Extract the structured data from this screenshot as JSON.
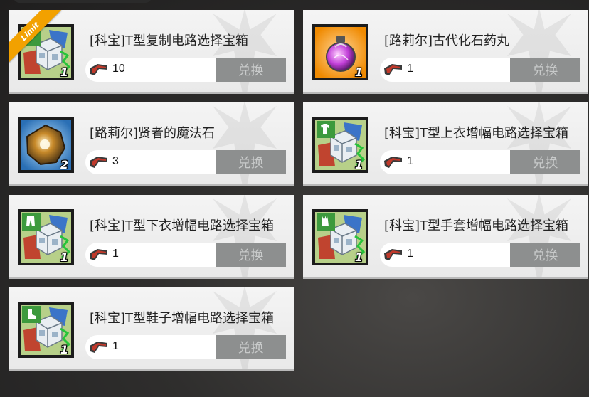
{
  "exchange_label": "兑换",
  "limit_label": "Limit",
  "items": [
    {
      "name": "[科宝]T型复制电路选择宝箱",
      "cost": "10",
      "qty": "1",
      "icon": "circuit-chip-gear-icon",
      "limit": true
    },
    {
      "name": "[路莉尔]古代化石药丸",
      "cost": "1",
      "qty": "1",
      "icon": "fossil-pill-orb-icon",
      "limit": false
    },
    {
      "name": "[路莉尔]贤者的魔法石",
      "cost": "3",
      "qty": "2",
      "icon": "magic-stone-icon",
      "limit": false
    },
    {
      "name": "[科宝]T型上衣增幅电路选择宝箱",
      "cost": "1",
      "qty": "1",
      "icon": "circuit-chip-shirt-icon",
      "limit": false
    },
    {
      "name": "[科宝]T型下衣增幅电路选择宝箱",
      "cost": "1",
      "qty": "1",
      "icon": "circuit-chip-pants-icon",
      "limit": false
    },
    {
      "name": "[科宝]T型手套增幅电路选择宝箱",
      "cost": "1",
      "qty": "1",
      "icon": "circuit-chip-glove-icon",
      "limit": false
    },
    {
      "name": "[科宝]T型鞋子增幅电路选择宝箱",
      "cost": "1",
      "qty": "1",
      "icon": "circuit-chip-boot-icon",
      "limit": false
    }
  ],
  "colors": {
    "limit_ribbon": "#f2a100",
    "button_disabled": "#8d8f8f",
    "card_bg": "#f0f0f0"
  }
}
